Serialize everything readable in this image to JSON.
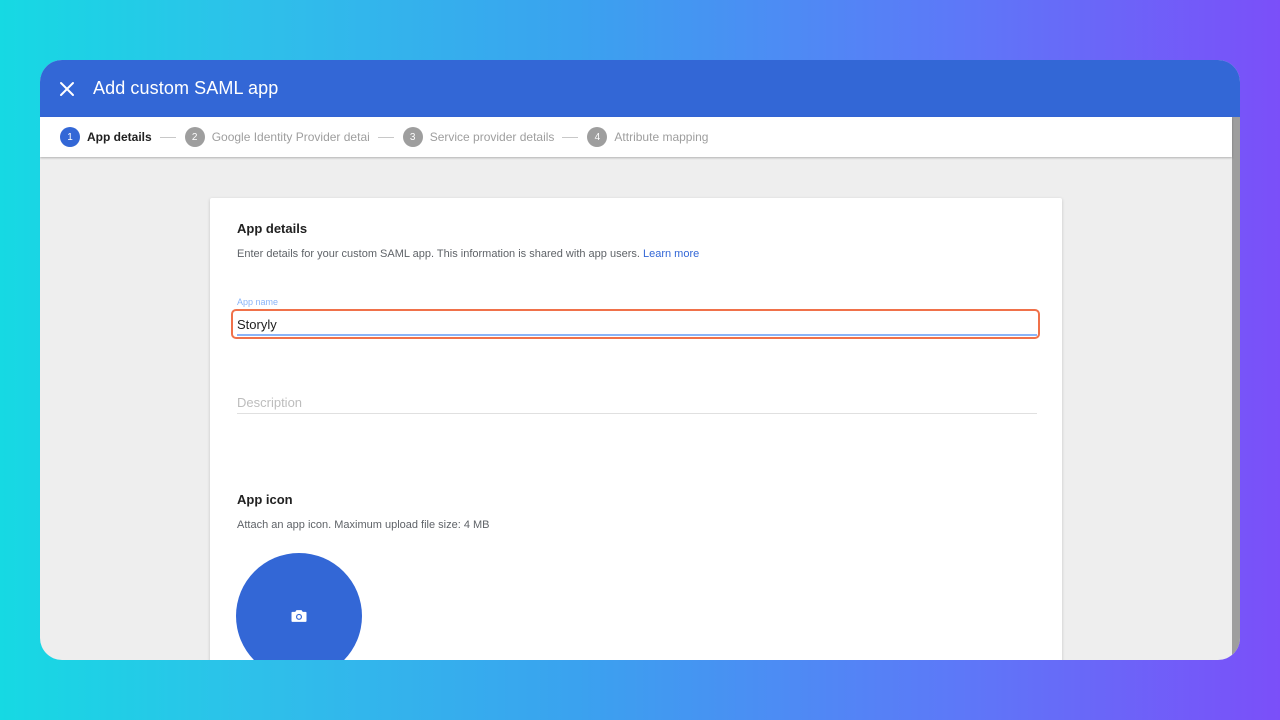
{
  "dialog": {
    "title": "Add custom SAML app"
  },
  "steps": [
    {
      "num": "1",
      "label": "App details",
      "active": true
    },
    {
      "num": "2",
      "label": "Google Identity Provider details",
      "active": false
    },
    {
      "num": "3",
      "label": "Service provider details",
      "active": false
    },
    {
      "num": "4",
      "label": "Attribute mapping",
      "active": false
    }
  ],
  "app_details": {
    "title": "App details",
    "description": "Enter details for your custom SAML app. This information is shared with app users.",
    "learn_more": "Learn more",
    "app_name_label": "App name",
    "app_name_value": "Storyly",
    "description_placeholder": "Description"
  },
  "app_icon": {
    "title": "App icon",
    "description": "Attach an app icon. Maximum upload file size: 4 MB"
  },
  "icons": {
    "close": "close-icon",
    "upload": "camera-icon"
  },
  "colors": {
    "primary": "#3367d6",
    "highlight": "#f0714a"
  }
}
